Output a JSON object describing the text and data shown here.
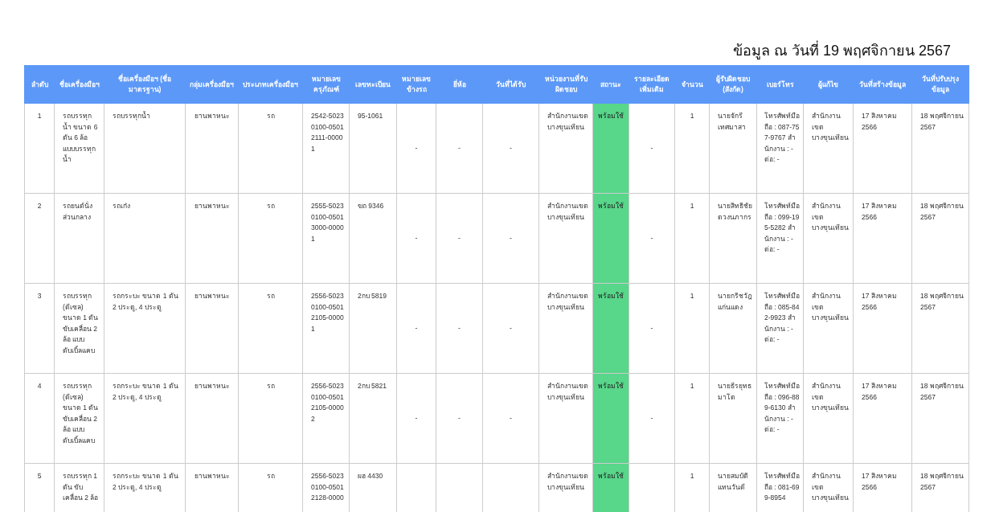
{
  "title": "ข้อมูล ณ วันที่ 19 พฤศจิกายน 2567",
  "table": {
    "columns": [
      "ลำดับ",
      "ชื่อเครื่องมือฯ",
      "ชื่อเครื่องมือฯ (ชื่อมาตรฐาน)",
      "กลุ่มเครื่องมือฯ",
      "ประเภทเครื่องมือฯ",
      "หมายเลขครุภัณฑ์",
      "เลขทะเบียน",
      "หมายเลขข้างรถ",
      "ยี่ห้อ",
      "วันที่ได้รับ",
      "หน่วยงานที่รับผิดชอบ",
      "สถานะ",
      "รายละเอียดเพิ่มเติม",
      "จำนวน",
      "ผู้รับผิดชอบ (สังกัด)",
      "เบอร์โทร",
      "ผู้แก้ไข",
      "วันที่สร้างข้อมูล",
      "วันที่ปรับปรุงข้อมูล"
    ],
    "rows": [
      {
        "no": "1",
        "name": "รถบรรทุกน้ำ ขนาด 6 ตัน 6 ล้อ แบบบรรทุกน้ำ",
        "standard_name": "รถบรรทุกน้ำ",
        "group": "ยานพาหนะ",
        "type": "รถ",
        "asset_number": "2542-5023 0100-0501 2111-0000 1",
        "registration": "95-1061",
        "side_number": "-",
        "brand": "-",
        "received_date": "-",
        "department": "สำนักงานเขตบางขุนเทียน",
        "status": {
          "label": "พร้อมใช้",
          "color": "#58d68a"
        },
        "details": "-",
        "quantity": "1",
        "responsible": "นายจักรี เทศมาสา",
        "phone": "โทรศัพท์มือถือ : 087-757-9767 สำนักงาน : -  ต่อ: -",
        "editor": "สำนักงานเขตบางขุนเทียน",
        "created": "17 สิงหาคม 2566",
        "updated": "18 พฤศจิกายน 2567"
      },
      {
        "no": "2",
        "name": "รถยนต์นั่งส่วนกลาง",
        "standard_name": "รถเก๋ง",
        "group": "ยานพาหนะ",
        "type": "รถ",
        "asset_number": "2555-5023 0100-0501 3000-0000 1",
        "registration": "ฆถ 9346",
        "side_number": "-",
        "brand": "-",
        "received_date": "-",
        "department": "สำนักงานเขตบางขุนเทียน",
        "status": {
          "label": "พร้อมใช้",
          "color": "#58d68a"
        },
        "details": "-",
        "quantity": "1",
        "responsible": "นายสิทธิชัย ดวงนภากร",
        "phone": "โทรศัพท์มือถือ : 099-195-5282 สำนักงาน : -  ต่อ: -",
        "editor": "สำนักงานเขตบางขุนเทียน",
        "created": "17 สิงหาคม 2566",
        "updated": "18 พฤศจิกายน 2567"
      },
      {
        "no": "3",
        "name": "รถบรรทุก (ดีเซล) ขนาด 1 ตัน ขับเคลื่อน 2 ล้อ แบบดับเบิ้ลแคบ",
        "standard_name": "รถกระบะ ขนาด 1 ตัน 2 ประตู, 4 ประตู",
        "group": "ยานพาหนะ",
        "type": "รถ",
        "asset_number": "2556-5023 0100-0501 2105-0000 1",
        "registration": "2กบ 5819",
        "side_number": "-",
        "brand": "-",
        "received_date": "-",
        "department": "สำนักงานเขตบางขุนเทียน",
        "status": {
          "label": "พร้อมใช้",
          "color": "#58d68a"
        },
        "details": "-",
        "quantity": "1",
        "responsible": "นายกริชวัฎ แก่นแดง",
        "phone": "โทรศัพท์มือถือ : 085-842-9923 สำนักงาน : -  ต่อ: -",
        "editor": "สำนักงานเขตบางขุนเทียน",
        "created": "17 สิงหาคม 2566",
        "updated": "18 พฤศจิกายน 2567"
      },
      {
        "no": "4",
        "name": "รถบรรทุก (ดีเซล) ขนาด 1 ตัน ขับเคลื่อน 2 ล้อ แบบดับเบิ้ลแคบ",
        "standard_name": "รถกระบะ ขนาด 1 ตัน 2 ประตู, 4 ประตู",
        "group": "ยานพาหนะ",
        "type": "รถ",
        "asset_number": "2556-5023 0100-0501 2105-0000 2",
        "registration": "2กบ 5821",
        "side_number": "-",
        "brand": "-",
        "received_date": "-",
        "department": "สำนักงานเขตบางขุนเทียน",
        "status": {
          "label": "พร้อมใช้",
          "color": "#58d68a"
        },
        "details": "-",
        "quantity": "1",
        "responsible": "นายธีรยุทธ มาโต",
        "phone": "โทรศัพท์มือถือ : 096-889-6130 สำนักงาน : -  ต่อ: -",
        "editor": "สำนักงานเขตบางขุนเทียน",
        "created": "17 สิงหาคม 2566",
        "updated": "18 พฤศจิกายน 2567"
      },
      {
        "no": "5",
        "name": "รถบรรทุก 1 ตัน ขับเคลื่อน 2 ล้อ",
        "standard_name": "รถกระบะ ขนาด 1 ตัน 2 ประตู, 4 ประตู",
        "group": "ยานพาหนะ",
        "type": "รถ",
        "asset_number": "2556-5023 0100-0501 2128-0000",
        "registration": "ผฮ 4430",
        "department": "สำนักงานเขตบางขุนเทียน",
        "status": {
          "label": "พร้อมใช้",
          "color": "#58d68a"
        },
        "quantity": "1",
        "responsible": "นายสมบัติ แทนวันดี",
        "phone": "โทรศัพท์มือถือ : 081-699-8954",
        "editor": "สำนักงานเขตบางขุนเทียน",
        "created": "17 สิงหาคม 2566",
        "updated": "18 พฤศจิกายน 2567"
      }
    ]
  }
}
